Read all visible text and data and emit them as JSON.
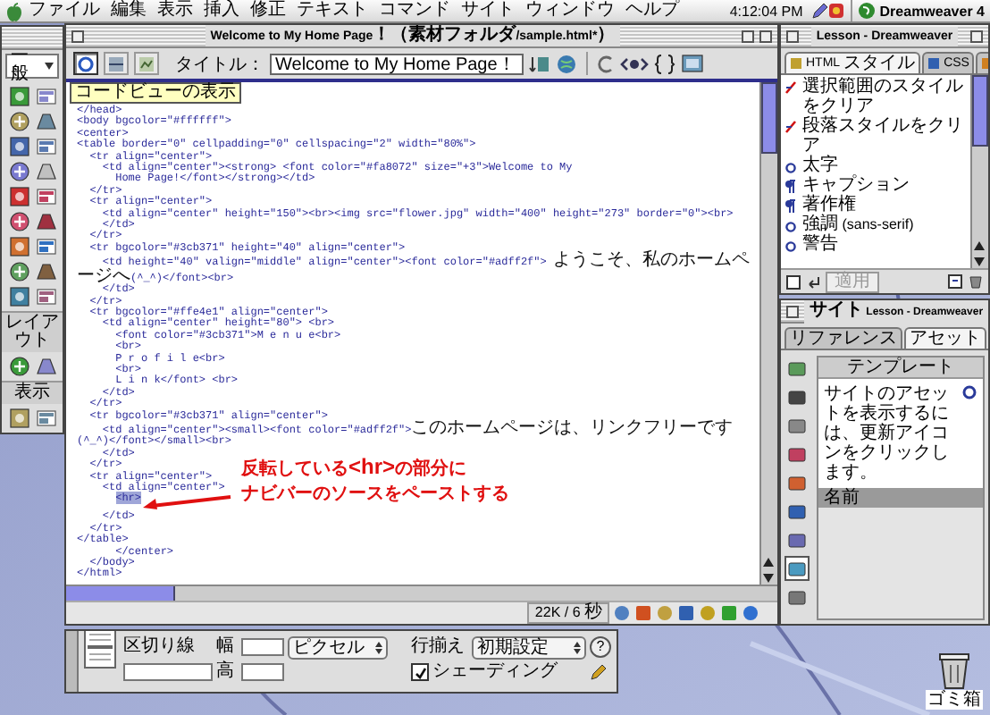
{
  "menu_bar": {
    "items": [
      "ファイル",
      "編集",
      "表示",
      "挿入",
      "修正",
      "テキスト",
      "コマンド",
      "サイト",
      "ウィンドウ",
      "ヘルプ"
    ],
    "clock": "4:12:04 PM",
    "app_name": "Dreamweaver 4"
  },
  "objects_panel": {
    "category": "一般",
    "sections": [
      {
        "label": "レイアウト"
      },
      {
        "label": "表示"
      }
    ]
  },
  "document": {
    "title": "Welcome to My Home Page！（素材フォルダ/sample.html*）",
    "view_buttons": [
      {
        "selected": true
      },
      {
        "selected": false
      },
      {
        "selected": false
      }
    ],
    "title_label": "タイトル：",
    "title_value": "Welcome to My Home Page！",
    "tooltip": "コードビューの表示",
    "status": "22K / 6 秒",
    "code_lines": [
      {
        "text": "</head>",
        "selected": false
      },
      {
        "text": "<body bgcolor=\"#ffffff\">",
        "selected": false
      },
      {
        "text": "<center>",
        "selected": false
      },
      {
        "text": "<table border=\"0\" cellpadding=\"0\" cellspacing=\"2\" width=\"80%\">",
        "selected": false
      },
      {
        "text": "  <tr align=\"center\">",
        "selected": false
      },
      {
        "text": "    <td align=\"center\"><strong> <font color=\"#fa8072\" size=\"+3\">Welcome to My",
        "selected": false
      },
      {
        "text": "      Home Page!</font></strong></td>",
        "selected": false
      },
      {
        "text": "  </tr>",
        "selected": false
      },
      {
        "text": "  <tr align=\"center\">",
        "selected": false
      },
      {
        "text": "    <td align=\"center\" height=\"150\"><br><img src=\"flower.jpg\" width=\"400\" height=\"273\" border=\"0\"><br>",
        "selected": false
      },
      {
        "text": "    </td>",
        "selected": false
      },
      {
        "text": "  </tr>",
        "selected": false
      },
      {
        "text": "  <tr bgcolor=\"#3cb371\" height=\"40\" align=\"center\">",
        "selected": false
      },
      {
        "text": "    <td height=\"40\" valign=\"middle\" align=\"center\"><font color=\"#adff2f\"> ようこそ、私のホームページへ(^_^)</font><br>",
        "selected": false
      },
      {
        "text": "    </td>",
        "selected": false
      },
      {
        "text": "  </tr>",
        "selected": false
      },
      {
        "text": "  <tr bgcolor=\"#ffe4e1\" align=\"center\">",
        "selected": false
      },
      {
        "text": "    <td align=\"center\" height=\"80\"> <br>",
        "selected": false
      },
      {
        "text": "      <font color=\"#3cb371\">M e n u e<br>",
        "selected": false
      },
      {
        "text": "      <br>",
        "selected": false
      },
      {
        "text": "      P r o f i l e<br>",
        "selected": false
      },
      {
        "text": "      <br>",
        "selected": false
      },
      {
        "text": "      L i n k</font> <br>",
        "selected": false
      },
      {
        "text": "    </td>",
        "selected": false
      },
      {
        "text": "  </tr>",
        "selected": false
      },
      {
        "text": "  <tr bgcolor=\"#3cb371\" align=\"center\">",
        "selected": false
      },
      {
        "text": "    <td align=\"center\"><small><font color=\"#adff2f\">このホームページは、リンクフリーです(^_^)</font></small><br>",
        "selected": false
      },
      {
        "text": "    </td>",
        "selected": false
      },
      {
        "text": "  </tr>",
        "selected": false
      },
      {
        "text": "  <tr align=\"center\">",
        "selected": false
      },
      {
        "text": "    <td align=\"center\">",
        "selected": false
      },
      {
        "text": "      <hr>",
        "selected": true,
        "note": [
          "反転している<hr>の部分に",
          "ナビバーのソースをペーストする"
        ]
      },
      {
        "text": "    </td>",
        "selected": false
      },
      {
        "text": "  </tr>",
        "selected": false
      },
      {
        "text": "</table>",
        "selected": false
      },
      {
        "text": "      </center>",
        "selected": false
      },
      {
        "text": "  </body>",
        "selected": false
      },
      {
        "text": "</html>",
        "selected": false
      }
    ]
  },
  "styles_panel": {
    "title": "Lesson - Dreamweaver",
    "tabs": [
      {
        "label": "HTML スタイル",
        "selected": true
      },
      {
        "label": "CSS",
        "selected": false
      },
      {
        "selected": false
      }
    ],
    "styles": [
      {
        "kind": "clear",
        "label": "選択範囲のスタイルをクリア"
      },
      {
        "kind": "clear",
        "label": "段落スタイルをクリア"
      },
      {
        "kind": "character",
        "label": "太字"
      },
      {
        "kind": "paragraph",
        "label": "キャプション"
      },
      {
        "kind": "paragraph",
        "label": "著作権"
      },
      {
        "kind": "character",
        "label": "強調 (sans-serif)"
      },
      {
        "kind": "character",
        "label": "警告"
      }
    ],
    "apply_button": {
      "label": "適用",
      "disabled": true
    }
  },
  "site_panel": {
    "title": "サイト Lesson - Dreamweaver",
    "tabs": [
      {
        "label": "リファレンス",
        "selected": false
      },
      {
        "label": "アセット",
        "selected": true
      }
    ],
    "categories": [
      {
        "selected": false
      },
      {
        "selected": false
      },
      {
        "selected": false
      },
      {
        "selected": false
      },
      {
        "selected": false
      },
      {
        "selected": false
      },
      {
        "selected": false
      },
      {
        "selected": true
      },
      {
        "selected": false
      }
    ],
    "heading": "テンプレート",
    "message": "サイトのアセットを表示するには、更新アイコンをクリックします。",
    "column": "名前"
  },
  "inspector": {
    "title": "区切り線",
    "width_label": "幅",
    "unit": "ピクセル",
    "height_label": "高",
    "align_label": "行揃え",
    "align_value": "初期設定",
    "shading": {
      "label": "シェーディング",
      "checked": true
    },
    "help": "?"
  },
  "trash": {
    "label": "ゴミ箱"
  }
}
